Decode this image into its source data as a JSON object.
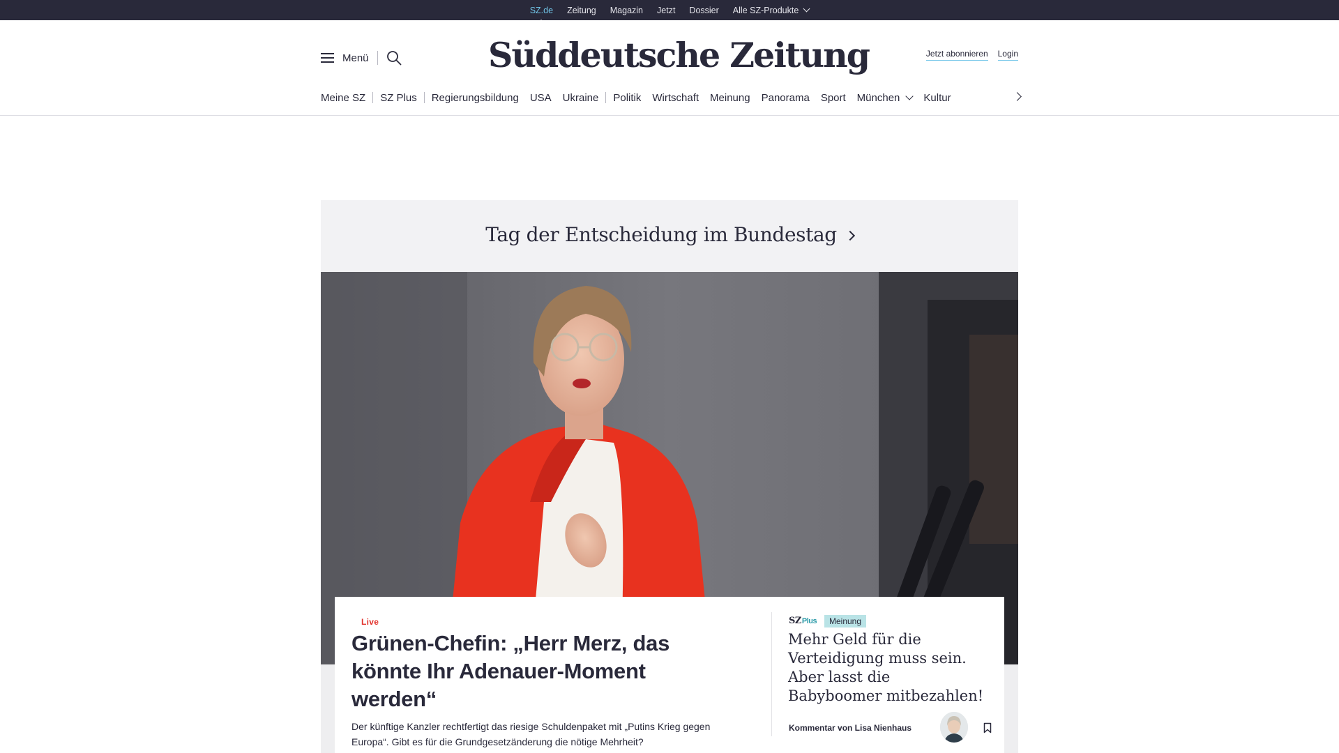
{
  "topbar": {
    "items": [
      "SZ.de",
      "Zeitung",
      "Magazin",
      "Jetzt",
      "Dossier",
      "Alle SZ-Produkte"
    ]
  },
  "header": {
    "menu_label": "Menü",
    "logo": "Süddeutsche Zeitung",
    "subscribe": "Jetzt abonnieren",
    "login": "Login"
  },
  "nav": {
    "items": [
      "Meine SZ",
      "SZ Plus",
      "Regierungsbildung",
      "USA",
      "Ukraine",
      "Politik",
      "Wirtschaft",
      "Meinung",
      "Panorama",
      "Sport",
      "München",
      "Kultur"
    ]
  },
  "theme": {
    "title": "Tag der Entscheidung im Bundestag"
  },
  "lead": {
    "kicker": "Live",
    "headline": "Grünen-Chefin: „Herr Merz, das könnte Ihr Adenauer-Moment werden“",
    "teaser": "Der künftige Kanzler rechtfertigt das riesige Schuldenpaket mit „Putins Krieg gegen Europa“. Gibt es für die Grundgesetzänderung die nötige Mehrheit?"
  },
  "opinion": {
    "brand": "SZ",
    "brand_suffix": "Plus",
    "tag": "Meinung",
    "title": "Mehr Geld für die Verteidigung muss sein. Aber lasst die Babyboomer mitbezahlen!",
    "author": "Kommentar von Lisa Nienhaus"
  },
  "colors": {
    "topbar_bg": "#29293a",
    "accent": "#71c5e8",
    "live_red": "#e2312b",
    "meinung_tag_bg": "#b9e3e6"
  }
}
